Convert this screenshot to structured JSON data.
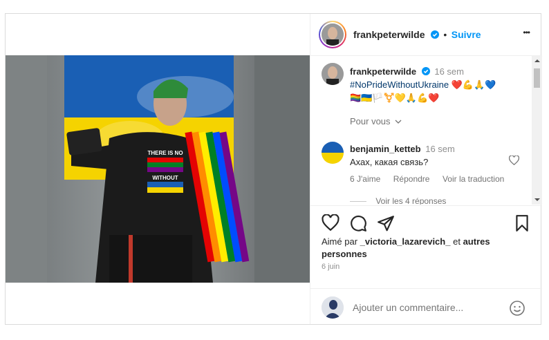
{
  "post": {
    "username": "frankpeterwilde",
    "follow_label": "Suivre",
    "more_label": "•••"
  },
  "caption": {
    "username": "frankpeterwilde",
    "time": "16 sem",
    "hashtag": "#NoPrideWithoutUkraine",
    "emojis_line1": "❤️💪🙏💙",
    "emojis_line2": "🏳️‍🌈🇺🇦🏳️⚧️💛🙏💪❤️",
    "see_translation": "Pour vous"
  },
  "comments": [
    {
      "username": "benjamin_ketteb",
      "time": "16 sem",
      "text": "Ахах, какая связь?",
      "likes": "6 J'aime",
      "reply": "Répondre",
      "translate": "Voir la traduction",
      "replies": "Voir les 4 réponses"
    }
  ],
  "liked_by": {
    "prefix": "Aimé par",
    "user": "_victoria_lazarevich_",
    "middle": "et",
    "suffix": "autres personnes"
  },
  "date": "6 juin",
  "add_comment": {
    "placeholder": "Ajouter un commentaire..."
  },
  "photo": {
    "shirt_line1": "THERE IS NO",
    "shirt_line2": "WITHOUT"
  },
  "colors": {
    "accent": "#0095f6",
    "hashtag": "#00376b",
    "flag_blue": "#1a5fb4",
    "flag_yellow": "#f5d300"
  }
}
